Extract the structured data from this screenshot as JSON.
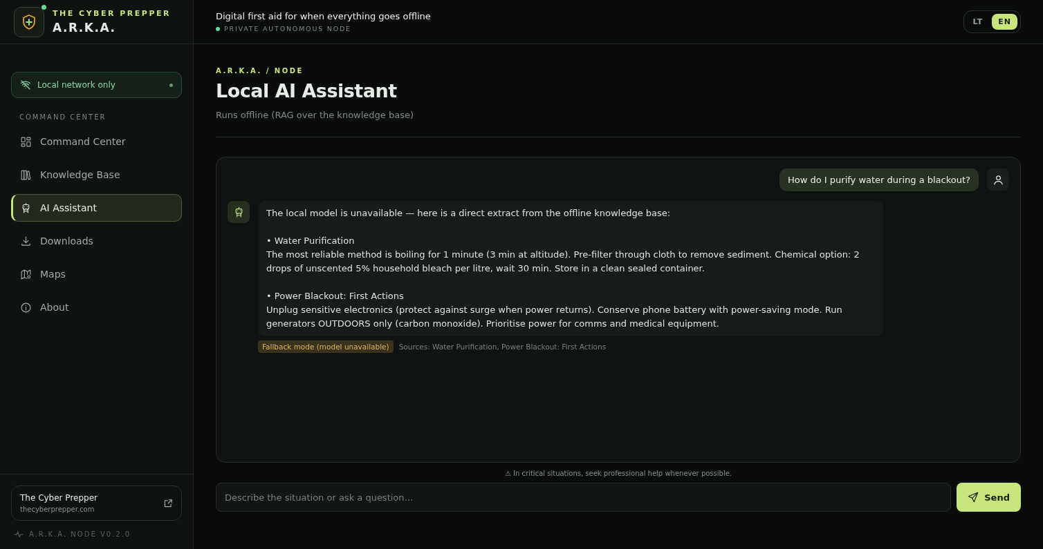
{
  "brand": {
    "eyebrow": "THE CYBER PREPPER",
    "title": "A.R.K.A.",
    "online": true
  },
  "network": {
    "label": "Local network only"
  },
  "sidebar": {
    "section": "COMMAND CENTER",
    "items": [
      {
        "label": "Command Center",
        "kind": "grid",
        "selected": false
      },
      {
        "label": "Knowledge Base",
        "kind": "books",
        "selected": false
      },
      {
        "label": "AI Assistant",
        "kind": "robot",
        "selected": true
      },
      {
        "label": "Downloads",
        "kind": "download",
        "selected": false
      },
      {
        "label": "Maps",
        "kind": "map",
        "selected": false
      },
      {
        "label": "About",
        "kind": "info",
        "selected": false
      }
    ]
  },
  "footer": {
    "card_title": "The Cyber Prepper",
    "card_url": "thecyberprepper.com",
    "version": "A.R.K.A. NODE V0.2.0"
  },
  "header": {
    "tagline": "Digital first aid for when everything goes offline",
    "status": "PRIVATE AUTONOMOUS NODE",
    "languages": [
      {
        "label": "LT",
        "selected": false
      },
      {
        "label": "EN",
        "selected": true
      }
    ]
  },
  "page": {
    "breadcrumb": "A.R.K.A. / NODE",
    "title": "Local AI Assistant",
    "subtitle": "Runs offline (RAG over the knowledge base)"
  },
  "messages": [
    {
      "kind": "user",
      "text": "How do I purify water during a blackout?"
    },
    {
      "kind": "assistant",
      "text": "The local model is unavailable — here is a direct extract from the offline knowledge base:\n\n• Water Purification\nThe most reliable method is boiling for 1 minute (3 min at altitude). Pre-filter through cloth to remove sediment. Chemical option: 2 drops of unscented 5% household bleach per litre, wait 30 min. Store in a clean sealed container.\n\n• Power Blackout: First Actions\nUnplug sensitive electronics (protect against surge when power returns). Conserve phone battery with power-saving mode. Run generators OUTDOORS only (carbon monoxide). Prioritise power for comms and medical equipment.",
      "badge": "Fallback mode (model unavailable)",
      "sources": "Sources: Water Purification, Power Blackout: First Actions"
    }
  ],
  "disclaimer": "⚠ In critical situations, seek professional help whenever possible.",
  "composer": {
    "placeholder": "Describe the situation or ask a question…",
    "button": "Send"
  }
}
